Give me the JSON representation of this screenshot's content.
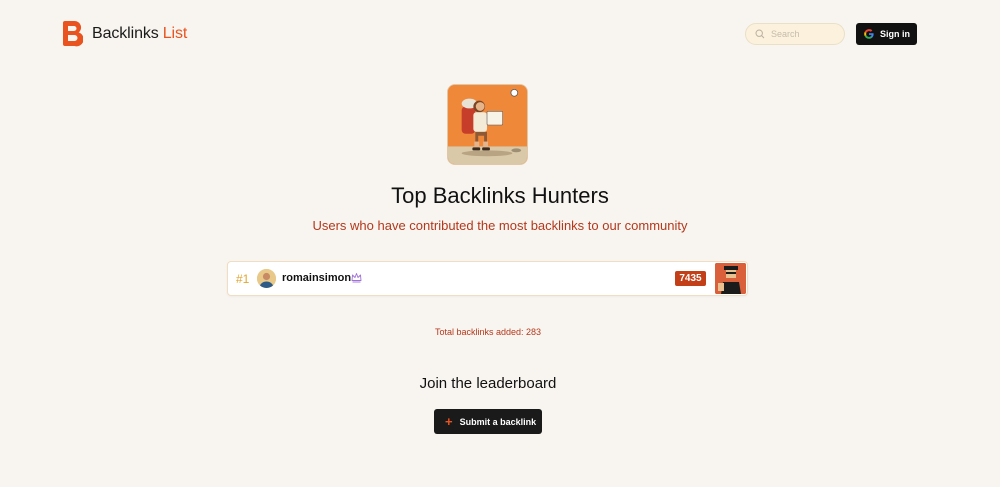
{
  "header": {
    "logo_text": "Backlinks",
    "logo_accent": "List",
    "search_placeholder": "Search",
    "signin_label": "Sign in",
    "icons": {
      "logo": "backlinks-logo-icon",
      "search": "search-icon",
      "google": "google-icon"
    }
  },
  "hero": {
    "title": "Top Backlinks Hunters",
    "subtitle": "Users who have contributed the most backlinks to our community",
    "image": "hiker-illustration"
  },
  "leaderboard": {
    "rows": [
      {
        "rank": "#1",
        "username": "romainsimon",
        "badge_icon": "crown-icon",
        "count": "7435"
      }
    ]
  },
  "total_text": "Total backlinks added: 283",
  "join": {
    "title": "Join the leaderboard",
    "button_label": "Submit a backlink",
    "button_icon": "plus-icon"
  },
  "colors": {
    "accent": "#e8531f",
    "brand_red": "#b4381c",
    "badge": "#c33f18",
    "rank_gold": "#e3a530",
    "background": "#f8f5f0"
  }
}
